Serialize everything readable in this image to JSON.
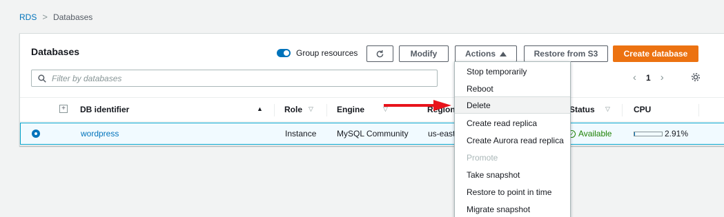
{
  "breadcrumb": {
    "root": "RDS",
    "separator": ">",
    "current": "Databases"
  },
  "panel": {
    "title": "Databases",
    "group_resources_label": "Group resources",
    "buttons": {
      "modify": "Modify",
      "actions": "Actions",
      "restore": "Restore from S3",
      "create": "Create database"
    },
    "filter_placeholder": "Filter by databases",
    "page_number": "1"
  },
  "table": {
    "columns": [
      "DB identifier",
      "Role",
      "Engine",
      "Region",
      "Status",
      "CPU"
    ],
    "row": {
      "identifier": "wordpress",
      "role": "Instance",
      "engine": "MySQL Community",
      "region": "us-east-",
      "status": "Available",
      "cpu": "2.91%",
      "cpu_fraction": 0.0291
    }
  },
  "actions_menu": {
    "items": [
      {
        "label": "Stop temporarily"
      },
      {
        "label": "Reboot"
      },
      {
        "label": "Delete"
      },
      {
        "label": "Create read replica"
      },
      {
        "label": "Create Aurora read replica"
      },
      {
        "label": "Promote"
      },
      {
        "label": "Take snapshot"
      },
      {
        "label": "Restore to point in time"
      },
      {
        "label": "Migrate snapshot"
      }
    ]
  },
  "colors": {
    "accent": "#0073bb",
    "primary_button": "#ec7211",
    "available": "#1d8102",
    "annotation_arrow": "#e8131b"
  }
}
